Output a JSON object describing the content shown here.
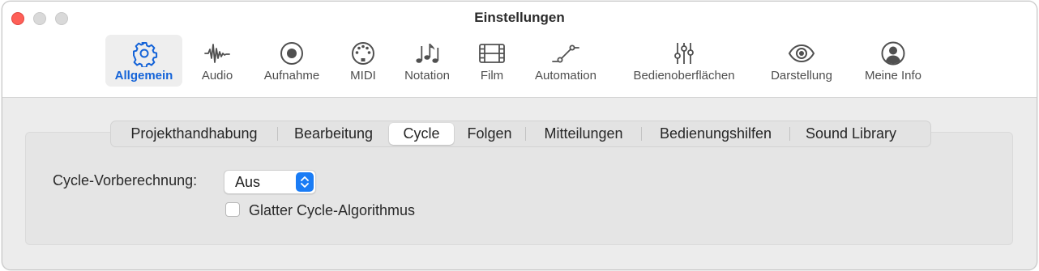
{
  "window": {
    "title": "Einstellungen"
  },
  "toolbar": {
    "items": [
      {
        "label": "Allgemein",
        "icon": "gear-icon",
        "selected": true
      },
      {
        "label": "Audio",
        "icon": "waveform-icon"
      },
      {
        "label": "Aufnahme",
        "icon": "record-icon"
      },
      {
        "label": "MIDI",
        "icon": "midi-port-icon"
      },
      {
        "label": "Notation",
        "icon": "music-notes-icon"
      },
      {
        "label": "Film",
        "icon": "film-strip-icon"
      },
      {
        "label": "Automation",
        "icon": "automation-curve-icon"
      },
      {
        "label": "Bedienoberflächen",
        "icon": "sliders-icon"
      },
      {
        "label": "Darstellung",
        "icon": "eye-icon"
      },
      {
        "label": "Meine Info",
        "icon": "person-circle-icon"
      }
    ]
  },
  "tabs": [
    {
      "label": "Projekthandhabung"
    },
    {
      "label": "Bearbeitung"
    },
    {
      "label": "Cycle",
      "active": true
    },
    {
      "label": "Folgen"
    },
    {
      "label": "Mitteilungen"
    },
    {
      "label": "Bedienungshilfen"
    },
    {
      "label": "Sound Library"
    }
  ],
  "settings": {
    "cycle_precalc_label": "Cycle-Vorberechnung:",
    "cycle_precalc_value": "Aus",
    "smooth_cycle_label": "Glatter Cycle-Algorithmus",
    "smooth_cycle_checked": false
  },
  "colors": {
    "accent": "#1463d8",
    "stepper": "#1a7cf5",
    "close": "#fe5f57"
  }
}
